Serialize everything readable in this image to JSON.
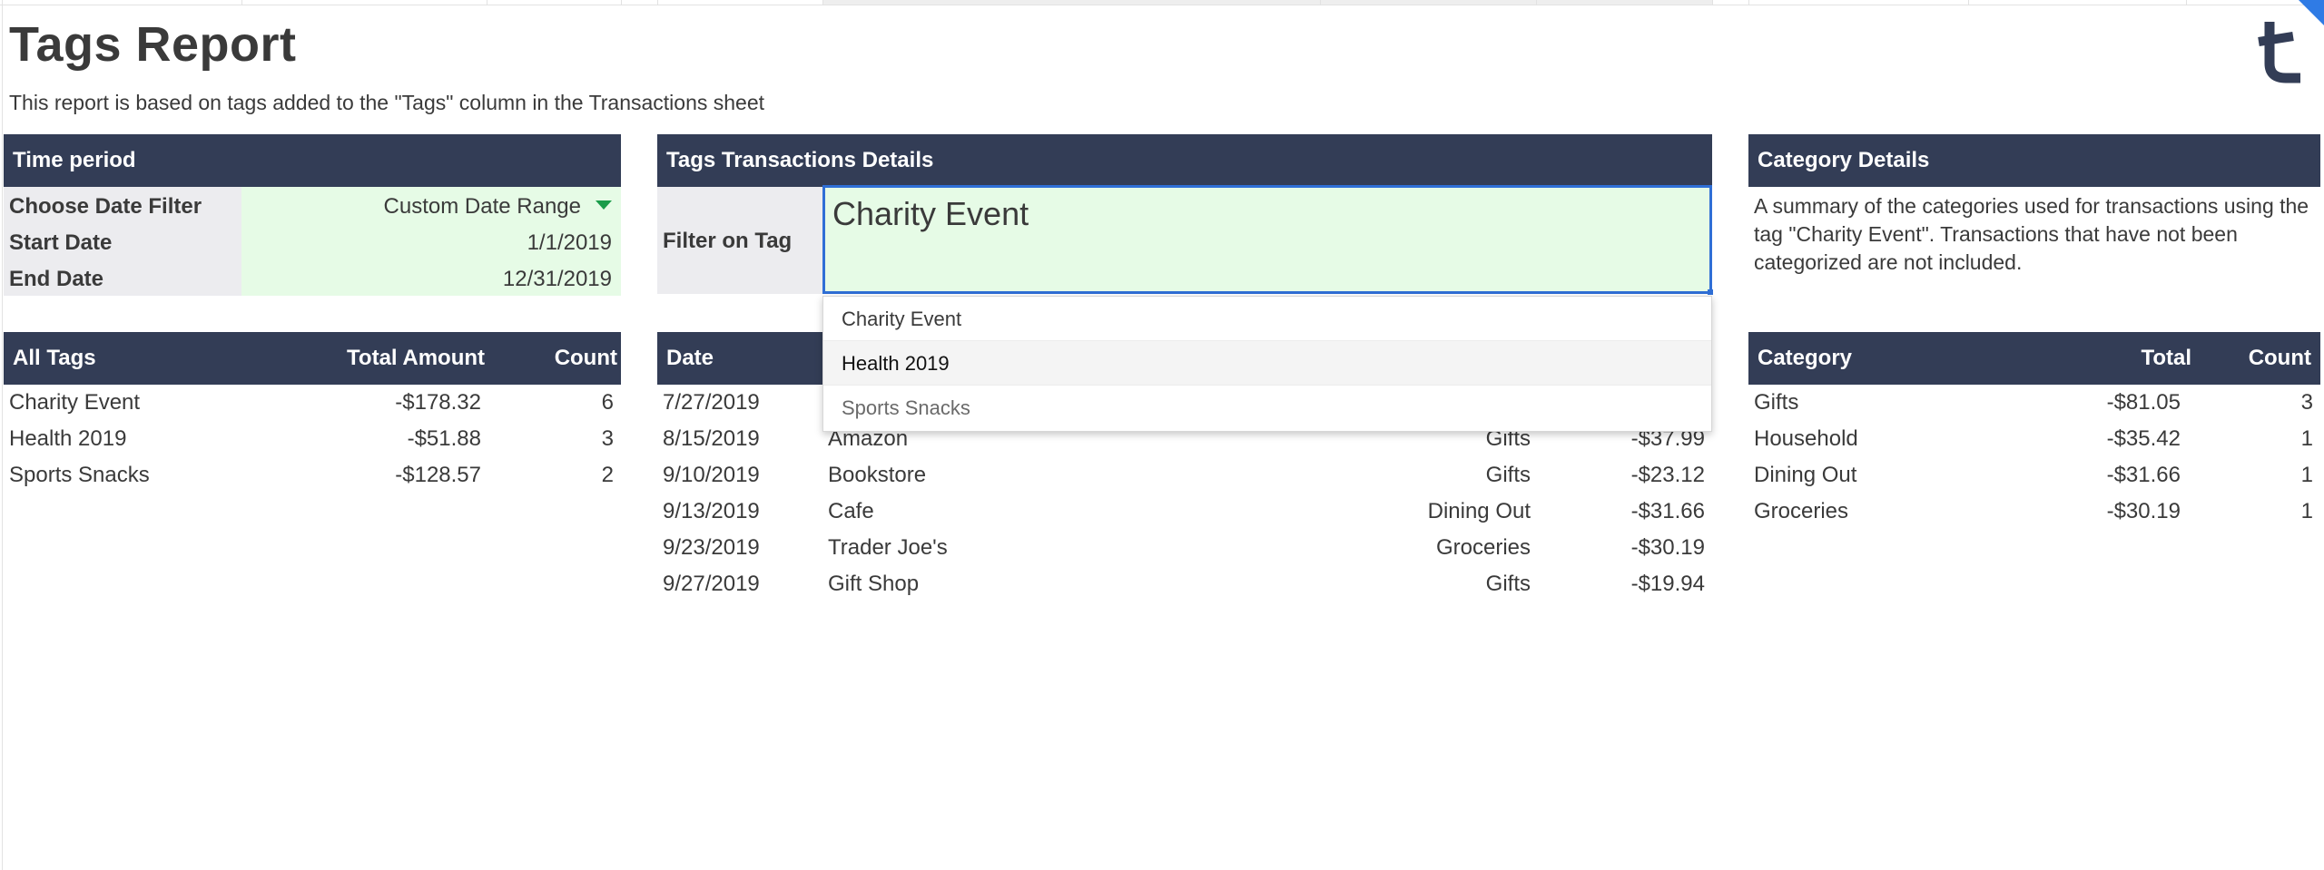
{
  "report": {
    "title": "Tags Report",
    "subtitle": "This report is based on tags added to the \"Tags\" column in the Transactions sheet"
  },
  "time_period": {
    "header": "Time period",
    "rows": [
      {
        "label": "Choose Date Filter",
        "value": "Custom Date Range"
      },
      {
        "label": "Start Date",
        "value": "1/1/2019"
      },
      {
        "label": "End Date",
        "value": "12/31/2019"
      }
    ]
  },
  "all_tags": {
    "headers": [
      "All Tags",
      "Total Amount",
      "Count"
    ],
    "rows": [
      {
        "tag": "Charity Event",
        "amount": "-$178.32",
        "count": "6"
      },
      {
        "tag": "Health 2019",
        "amount": "-$51.88",
        "count": "3"
      },
      {
        "tag": "Sports Snacks",
        "amount": "-$128.57",
        "count": "2"
      }
    ]
  },
  "tag_details": {
    "header": "Tags Transactions Details",
    "filter_label": "Filter on Tag",
    "filter_value": "Charity Event",
    "table_header_date": "Date",
    "dropdown_options": [
      "Charity Event",
      "Health 2019",
      "Sports Snacks"
    ],
    "rows": [
      {
        "date": "7/27/2019",
        "merchant": "",
        "category": "",
        "amount": ""
      },
      {
        "date": "8/15/2019",
        "merchant": "Amazon",
        "category": "Gifts",
        "amount": "-$37.99"
      },
      {
        "date": "9/10/2019",
        "merchant": "Bookstore",
        "category": "Gifts",
        "amount": "-$23.12"
      },
      {
        "date": "9/13/2019",
        "merchant": "Cafe",
        "category": "Dining Out",
        "amount": "-$31.66"
      },
      {
        "date": "9/23/2019",
        "merchant": "Trader Joe's",
        "category": "Groceries",
        "amount": "-$30.19"
      },
      {
        "date": "9/27/2019",
        "merchant": "Gift Shop",
        "category": "Gifts",
        "amount": "-$19.94"
      }
    ]
  },
  "category_details": {
    "header": "Category Details",
    "description": "A summary of the categories used for transactions using the tag \"Charity Event\". Transactions that have not been categorized are not included.",
    "headers": [
      "Category",
      "Total",
      "Count"
    ],
    "rows": [
      {
        "category": "Gifts",
        "total": "-$81.05",
        "count": "3"
      },
      {
        "category": "Household",
        "total": "-$35.42",
        "count": "1"
      },
      {
        "category": "Dining Out",
        "total": "-$31.66",
        "count": "1"
      },
      {
        "category": "Groceries",
        "total": "-$30.19",
        "count": "1"
      }
    ]
  },
  "icons": {
    "logo": "tiller-t-logo-icon",
    "dropdown": "dropdown-caret-icon"
  },
  "colors": {
    "header_bg": "#333d56",
    "input_bg": "#e6fbe6",
    "selection_border": "#2f6fd6",
    "label_bg": "#ececef",
    "caret": "#1a9c4a"
  }
}
